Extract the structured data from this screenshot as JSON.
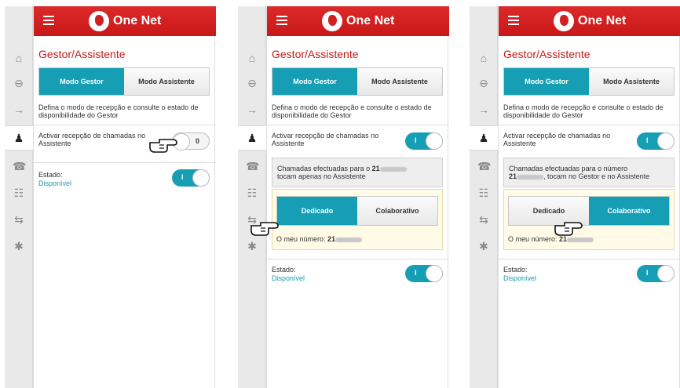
{
  "colors": {
    "brand_red": "#d21f1f",
    "accent_teal": "#169fb4",
    "status_text": "#1d97b0",
    "notice_bg": "#fffbe6"
  },
  "app": {
    "brand": "One Net",
    "menu_icon": "hamburger-icon",
    "logo_icon": "vodafone-logo"
  },
  "rail_icons": [
    "home-icon",
    "minus-circle-icon",
    "forward-icon",
    "manager-assistant-icon",
    "call-icon",
    "group-icon",
    "mobile-transfer-icon",
    "gear-icon"
  ],
  "screens": [
    {
      "title": "Gestor/Assistente",
      "tabs": [
        {
          "label": "Modo Gestor",
          "selected": true
        },
        {
          "label": "Modo Assistente",
          "selected": false
        }
      ],
      "description": "Defina o modo de recepção e consulte o estado de disponibilidade do Gestor",
      "activate_label": "Activar recepção de chamadas no Assistente",
      "activate_toggle": "0",
      "estado_label": "Estado:",
      "estado_value": "Disponível",
      "estado_toggle": "I"
    },
    {
      "title": "Gestor/Assistente",
      "tabs": [
        {
          "label": "Modo Gestor",
          "selected": true
        },
        {
          "label": "Modo Assistente",
          "selected": false
        }
      ],
      "description": "Defina o modo de recepção e consulte o estado de disponibilidade do Gestor",
      "activate_label": "Activar recepção de chamadas no Assistente",
      "activate_toggle": "I",
      "info_prefix": "Chamadas efectuadas para o",
      "info_number": "21",
      "info_suffix": "tocam apenas no Assistente",
      "modes": [
        {
          "label": "Dedicado",
          "selected": true
        },
        {
          "label": "Colaborativo",
          "selected": false
        }
      ],
      "my_number_label": "O meu número:",
      "my_number": "21",
      "estado_label": "Estado:",
      "estado_value": "Disponível",
      "estado_toggle": "I"
    },
    {
      "title": "Gestor/Assistente",
      "tabs": [
        {
          "label": "Modo Gestor",
          "selected": true
        },
        {
          "label": "Modo Assistente",
          "selected": false
        }
      ],
      "description": "Defina o modo de recepção e consulte o estado de disponibilidade do Gestor",
      "activate_label": "Activar recepção de chamadas no Assistente",
      "activate_toggle": "I",
      "info_prefix": "Chamadas efectuadas para o número",
      "info_number": "21",
      "info_suffix": ", tocam no Gestor e no Assistente",
      "modes": [
        {
          "label": "Dedicado",
          "selected": false
        },
        {
          "label": "Colaborativo",
          "selected": true
        }
      ],
      "my_number_label": "O meu número:",
      "my_number": "21",
      "estado_label": "Estado:",
      "estado_value": "Disponível",
      "estado_toggle": "I"
    }
  ]
}
